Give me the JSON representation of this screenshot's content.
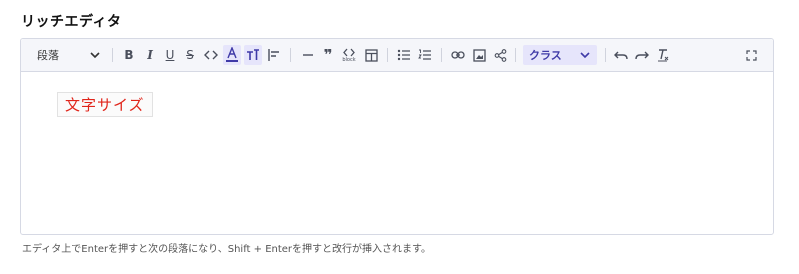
{
  "field": {
    "label": "リッチエディタ"
  },
  "toolbar": {
    "paragraph_select": {
      "value": "段落"
    },
    "class_select": {
      "value": "クラス"
    },
    "buttons": [
      "bold",
      "italic",
      "underline",
      "strikethrough",
      "code",
      "text-color",
      "font-size",
      "align-left",
      "horizontal-rule",
      "blockquote",
      "code-block",
      "table",
      "bullet-list",
      "ordered-list",
      "link",
      "image",
      "share",
      "undo",
      "redo",
      "clear-format",
      "fullscreen"
    ],
    "code_block_caption": "block"
  },
  "content": {
    "styled_text": "文字サイズ",
    "text_color": "#e0251b"
  },
  "help_text": "エディタ上でEnterを押すと次の段落になり、Shift + Enterを押すと改行が挿入されます。",
  "colors": {
    "accent": "#3f3aa7",
    "accent_bg": "#e6e5fb",
    "border": "#d6d9e4"
  }
}
